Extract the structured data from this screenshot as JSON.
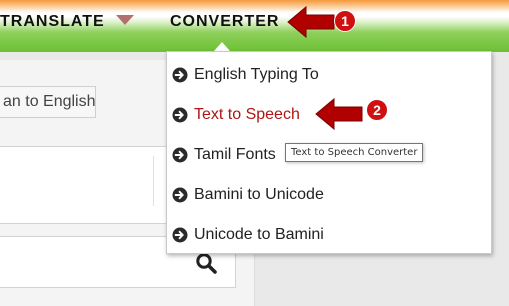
{
  "nav": {
    "translate_label": "TRANSLATE",
    "converter_label": "CONVERTER",
    "colors": {
      "saffron": "#f59a3c",
      "green": "#6cc034"
    }
  },
  "page": {
    "lang_button_label": "an to English"
  },
  "dropdown": {
    "items": [
      {
        "label": "English Typing To",
        "icon": "arrow-circle-right-icon"
      },
      {
        "label": "Text to Speech",
        "icon": "arrow-circle-right-icon",
        "active": true,
        "color": "#b01414"
      },
      {
        "label": "Tamil Fonts",
        "icon": "arrow-circle-right-icon"
      },
      {
        "label": "Bamini to Unicode",
        "icon": "arrow-circle-right-icon"
      },
      {
        "label": "Unicode to Bamini",
        "icon": "arrow-circle-right-icon"
      }
    ]
  },
  "tooltip": {
    "text": "Text to Speech Converter"
  },
  "annotations": {
    "step_1": "1",
    "step_2": "2",
    "color": "#b00000"
  }
}
